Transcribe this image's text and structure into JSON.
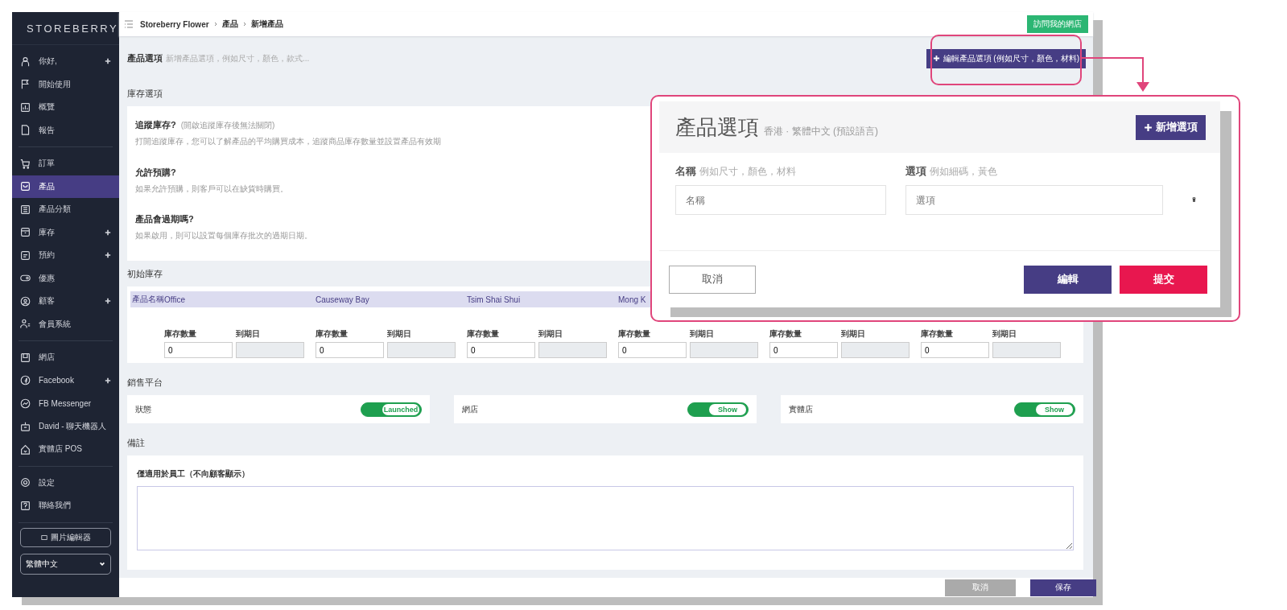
{
  "sidebar": {
    "logo": "STOREBERRY",
    "groups": [
      {
        "items": [
          {
            "label": "你好,",
            "expandable": true,
            "selected": false
          },
          {
            "label": "開始使用",
            "expandable": false,
            "selected": false
          },
          {
            "label": "概覽",
            "expandable": false,
            "selected": false
          },
          {
            "label": "報告",
            "expandable": false,
            "selected": false
          }
        ]
      },
      {
        "items": [
          {
            "label": "訂單",
            "expandable": false,
            "selected": false
          },
          {
            "label": "產品",
            "expandable": false,
            "selected": true
          },
          {
            "label": "產品分類",
            "expandable": false,
            "selected": false
          },
          {
            "label": "庫存",
            "expandable": true,
            "selected": false
          },
          {
            "label": "預約",
            "expandable": true,
            "selected": false
          },
          {
            "label": "優惠",
            "expandable": false,
            "selected": false
          },
          {
            "label": "顧客",
            "expandable": true,
            "selected": false
          },
          {
            "label": "會員系統",
            "expandable": false,
            "selected": false
          }
        ]
      },
      {
        "items": [
          {
            "label": "網店",
            "expandable": false,
            "selected": false
          },
          {
            "label": "Facebook",
            "expandable": true,
            "selected": false
          },
          {
            "label": "FB Messenger",
            "expandable": false,
            "selected": false
          },
          {
            "label": "David - 聊天機器人",
            "expandable": false,
            "selected": false
          },
          {
            "label": "實體店 POS",
            "expandable": false,
            "selected": false
          }
        ]
      },
      {
        "items": [
          {
            "label": "設定",
            "expandable": false,
            "selected": false
          },
          {
            "label": "聯絡我們",
            "expandable": false,
            "selected": false
          }
        ]
      }
    ],
    "image_editor_button": "圖片編輯器",
    "language_select": "繁體中文"
  },
  "topbar": {
    "breadcrumb": [
      "Storeberry Flower",
      "產品",
      "新增產品"
    ],
    "visit_store_button": "訪問我的網店"
  },
  "product_options": {
    "title": "產品選項",
    "hint": "新增產品選項，例如尺寸，顏色，款式...",
    "edit_button": "編輯產品選項 (例如尺寸，顏色，材料)"
  },
  "inventory_options": {
    "title": "庫存選項",
    "items": [
      {
        "title": "追蹤庫存?",
        "note": "(開啟追蹤庫存後無法關閉)",
        "description": "打開追蹤庫存，您可以了解產品的平均購買成本，追蹤商品庫存數量並設置產品有效期"
      },
      {
        "title": "允許預購?",
        "description": "如果允許預購，則客戶可以在缺貨時購買。"
      },
      {
        "title": "產品會過期嗎?",
        "description": "如果啟用，則可以設置每個庫存批次的過期日期。"
      }
    ]
  },
  "initial_stock": {
    "title": "初始庫存",
    "name_header": "產品名稱",
    "locations": [
      {
        "name": "Office",
        "qty_label": "庫存數量",
        "date_label": "到期日",
        "qty": "0"
      },
      {
        "name": "Causeway Bay",
        "qty_label": "庫存數量",
        "date_label": "到期日",
        "qty": "0"
      },
      {
        "name": "Tsim Shai Shui",
        "qty_label": "庫存數量",
        "date_label": "到期日",
        "qty": "0"
      },
      {
        "name": "Mong K",
        "qty_label": "庫存數量",
        "date_label": "到期日",
        "qty": "0"
      },
      {
        "qty_label": "庫存數量",
        "date_label": "到期日",
        "qty": "0"
      },
      {
        "qty_label": "庫存數量",
        "date_label": "到期日",
        "qty": "0"
      }
    ]
  },
  "sales_channels": {
    "title": "銷售平台",
    "channels": [
      {
        "label": "狀態",
        "toggle": "Launched",
        "on": true
      },
      {
        "label": "網店",
        "toggle": "Show",
        "on": true
      },
      {
        "label": "實體店",
        "toggle": "Show",
        "on": true
      }
    ]
  },
  "notes": {
    "title": "備註",
    "label": "僅適用於員工（不向顧客顯示）"
  },
  "footer": {
    "cancel_button": "取消",
    "save_button": "保存"
  },
  "options_dialog": {
    "title": "產品選項",
    "language": "香港 · 繁體中文 (預設語言)",
    "add_button": "新增選項",
    "fields": [
      {
        "label": "名稱",
        "hint": "例如尺寸，顏色，材料",
        "placeholder": "名稱"
      },
      {
        "label": "選項",
        "hint": "例如細碼，黃色",
        "placeholder": "選項"
      }
    ],
    "cancel_button": "取消",
    "edit_button": "編輯",
    "submit_button": "提交"
  }
}
